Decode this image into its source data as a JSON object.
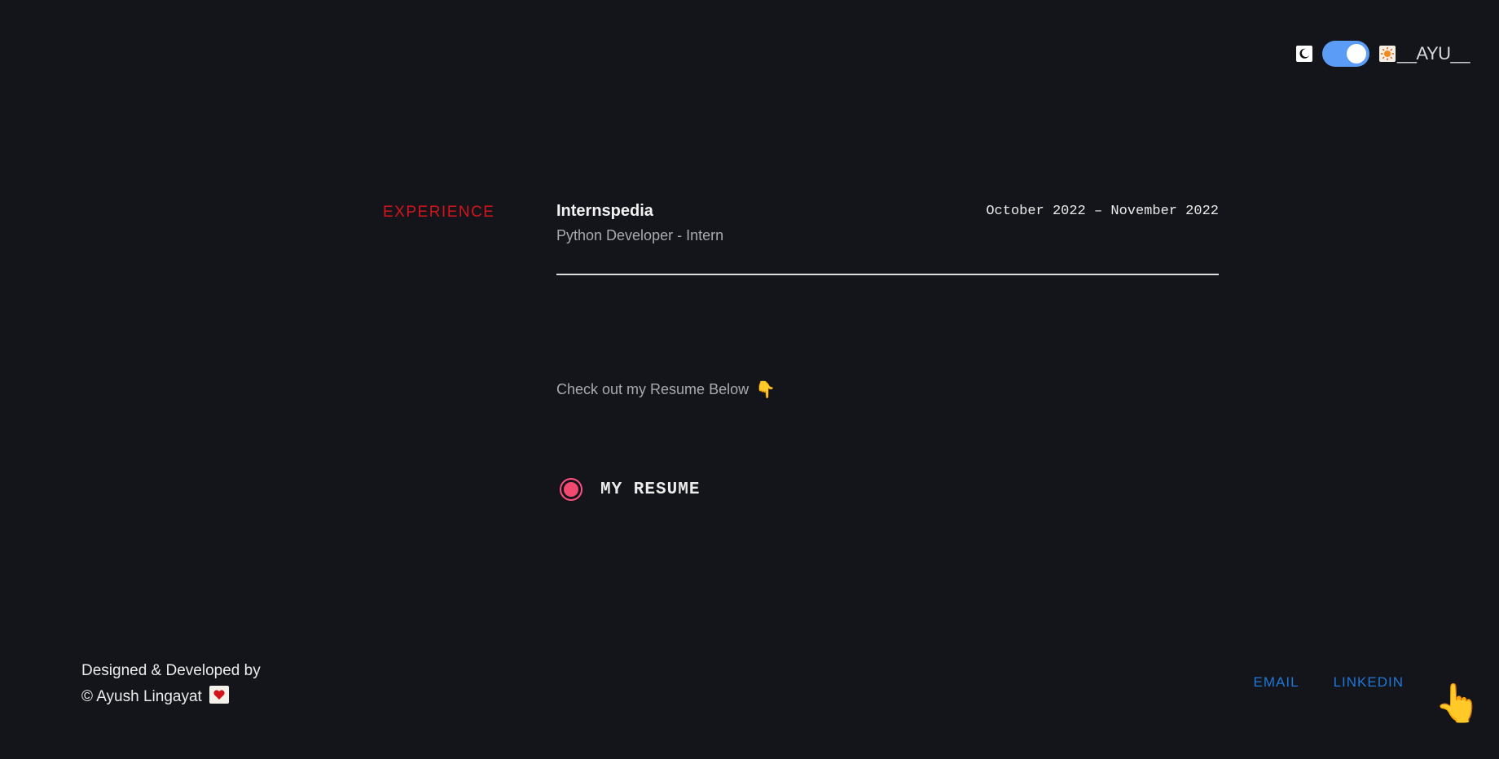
{
  "header": {
    "brand": "__AYU__",
    "theme_toggle": {
      "state": "on",
      "accent": "#5b9cf7"
    }
  },
  "experience": {
    "section_label": "EXPERIENCE",
    "jobs": [
      {
        "company": "Internspedia",
        "role": "Python Developer - Intern",
        "dates": "October 2022 – November 2022"
      }
    ]
  },
  "resume": {
    "note": "Check out my Resume Below",
    "note_icon": "point-down-icon",
    "link_label": "MY RESUME"
  },
  "footer": {
    "credit_line1": "Designed & Developed by",
    "credit_line2": "© Ayush Lingayat",
    "links": [
      {
        "label": "EMAIL"
      },
      {
        "label": "LINKEDIN"
      }
    ]
  },
  "colors": {
    "background": "#14151a",
    "section_accent": "#d3141c",
    "link": "#1f78d9",
    "resume_icon": "#f2496f"
  }
}
